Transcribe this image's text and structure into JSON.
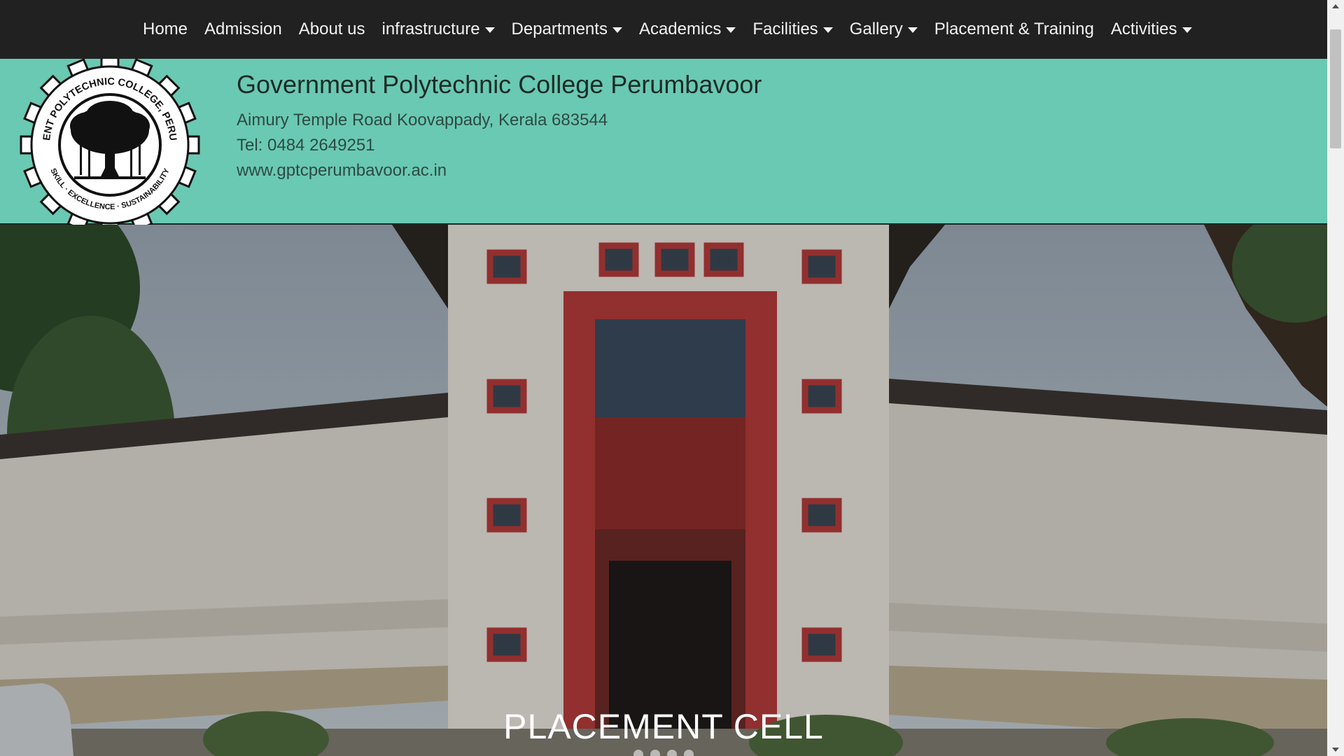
{
  "nav": {
    "items": [
      {
        "label": "Home",
        "dropdown": false
      },
      {
        "label": "Admission",
        "dropdown": false
      },
      {
        "label": "About us",
        "dropdown": false
      },
      {
        "label": "infrastructure",
        "dropdown": true
      },
      {
        "label": "Departments",
        "dropdown": true
      },
      {
        "label": "Academics",
        "dropdown": true
      },
      {
        "label": "Facilities",
        "dropdown": true
      },
      {
        "label": "Gallery",
        "dropdown": true
      },
      {
        "label": "Placement & Training",
        "dropdown": false
      },
      {
        "label": "Activities",
        "dropdown": true
      }
    ]
  },
  "header": {
    "college_name": "Government Polytechnic College Perumbavoor",
    "address": "Aimury Temple Road Koovappady, Kerala 683544",
    "phone": "Tel: 0484 2649251",
    "website": "www.gptcperumbavoor.ac.in",
    "logo": {
      "ring_text": "GOVERNMENT POLYTECHNIC COLLEGE, PERUMBAVOOR",
      "motto": "SKILL · EXCELLENCE · SUSTAINABILITY"
    }
  },
  "hero": {
    "caption": "PLACEMENT CELL"
  },
  "colors": {
    "navbar": "#212121",
    "header_band": "#6ac9b3",
    "building_accent": "#b23a3a"
  },
  "icons": {
    "dropdown": "caret-down-icon",
    "logo_emblem": "banyan-tree-gear-emblem"
  }
}
